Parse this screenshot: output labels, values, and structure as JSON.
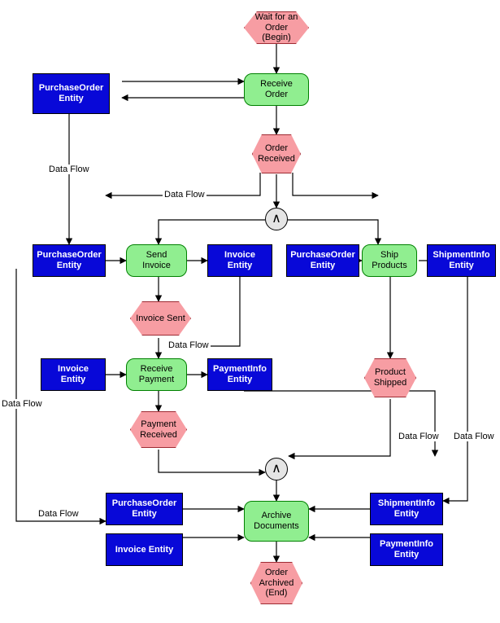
{
  "diagram": {
    "events": {
      "wait_order": "Wait for an Order (Begin)",
      "order_received": "Order Received",
      "invoice_sent": "Invoice Sent",
      "payment_received": "Payment Received",
      "product_shipped": "Product Shipped",
      "order_archived": "Order Archived (End)"
    },
    "activities": {
      "receive_order": "Receive Order",
      "send_invoice": "Send Invoice",
      "receive_payment": "Receive Payment",
      "ship_products": "Ship Products",
      "archive_documents": "Archive Documents"
    },
    "entities": {
      "purchase_order_top": "PurchaseOrder Entity",
      "purchase_order_left": "PurchaseOrder Entity",
      "purchase_order_mid": "PurchaseOrder Entity",
      "purchase_order_bottom": "PurchaseOrder Entity",
      "invoice_mid": "Invoice Entity",
      "invoice_left": "Invoice Entity",
      "invoice_bottom": "Invoice Entity",
      "payment_info_mid": "PaymentInfo Entity",
      "payment_info_bottom": "PaymentInfo Entity",
      "shipment_info_right": "ShipmentInfo Entity",
      "shipment_info_bottom": "ShipmentInfo Entity"
    },
    "gateways": {
      "and1": "∧",
      "and2": "∧"
    },
    "edge_labels": {
      "df1": "Data Flow",
      "df2": "Data Flow",
      "df3": "Data Flow",
      "df4": "Data Flow",
      "df5": "Data Flow",
      "df6": "Data Flow",
      "df7": "Data Flow"
    }
  }
}
